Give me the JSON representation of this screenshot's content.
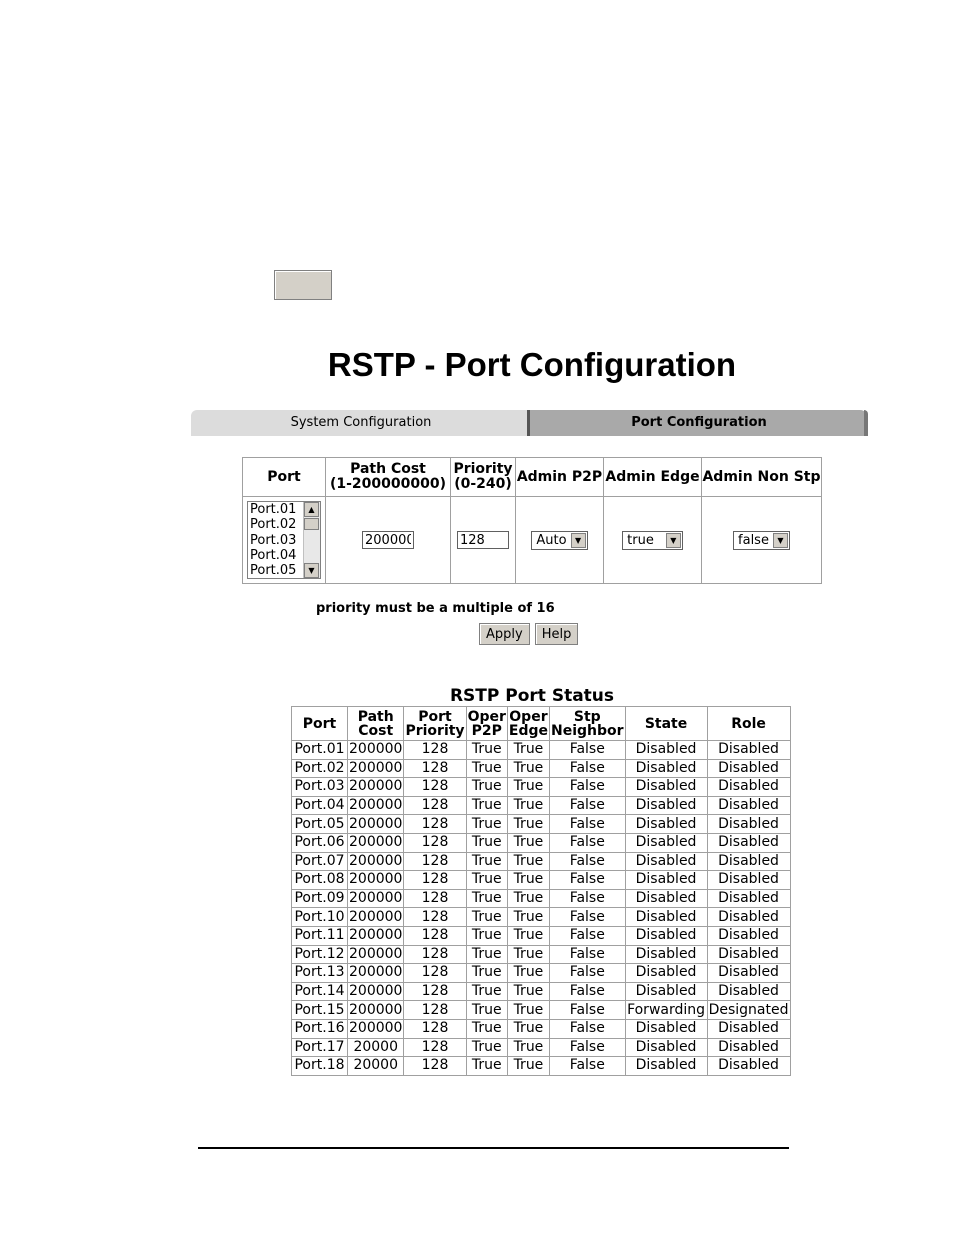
{
  "page_title": "RSTP - Port Configuration",
  "tabs": [
    {
      "label": "System Configuration"
    },
    {
      "label": "Port Configuration"
    }
  ],
  "config_table": {
    "headers": {
      "port": "Port",
      "path_cost": "Path Cost",
      "path_cost_range": "(1-200000000)",
      "priority": "Priority",
      "priority_range": "(0-240)",
      "admin_p2p": "Admin P2P",
      "admin_edge": "Admin Edge",
      "admin_non_stp": "Admin Non Stp"
    },
    "port_options": [
      "Port.01",
      "Port.02",
      "Port.03",
      "Port.04",
      "Port.05"
    ],
    "path_cost_value": "200000",
    "priority_value": "128",
    "admin_p2p_value": "Auto",
    "admin_edge_value": "true",
    "admin_non_stp_value": "false"
  },
  "note": "priority must be a multiple of 16",
  "buttons": {
    "apply": "Apply",
    "help": "Help"
  },
  "status": {
    "title": "RSTP Port Status",
    "headers": {
      "port": "Port",
      "path_cost_1": "Path",
      "path_cost_2": "Cost",
      "port_priority_1": "Port",
      "port_priority_2": "Priority",
      "oper_p2p_1": "Oper",
      "oper_p2p_2": "P2P",
      "oper_edge_1": "Oper",
      "oper_edge_2": "Edge",
      "stp_neighbor_1": "Stp",
      "stp_neighbor_2": "Neighbor",
      "state": "State",
      "role": "Role"
    },
    "rows": [
      [
        "Port.01",
        "200000",
        "128",
        "True",
        "True",
        "False",
        "Disabled",
        "Disabled"
      ],
      [
        "Port.02",
        "200000",
        "128",
        "True",
        "True",
        "False",
        "Disabled",
        "Disabled"
      ],
      [
        "Port.03",
        "200000",
        "128",
        "True",
        "True",
        "False",
        "Disabled",
        "Disabled"
      ],
      [
        "Port.04",
        "200000",
        "128",
        "True",
        "True",
        "False",
        "Disabled",
        "Disabled"
      ],
      [
        "Port.05",
        "200000",
        "128",
        "True",
        "True",
        "False",
        "Disabled",
        "Disabled"
      ],
      [
        "Port.06",
        "200000",
        "128",
        "True",
        "True",
        "False",
        "Disabled",
        "Disabled"
      ],
      [
        "Port.07",
        "200000",
        "128",
        "True",
        "True",
        "False",
        "Disabled",
        "Disabled"
      ],
      [
        "Port.08",
        "200000",
        "128",
        "True",
        "True",
        "False",
        "Disabled",
        "Disabled"
      ],
      [
        "Port.09",
        "200000",
        "128",
        "True",
        "True",
        "False",
        "Disabled",
        "Disabled"
      ],
      [
        "Port.10",
        "200000",
        "128",
        "True",
        "True",
        "False",
        "Disabled",
        "Disabled"
      ],
      [
        "Port.11",
        "200000",
        "128",
        "True",
        "True",
        "False",
        "Disabled",
        "Disabled"
      ],
      [
        "Port.12",
        "200000",
        "128",
        "True",
        "True",
        "False",
        "Disabled",
        "Disabled"
      ],
      [
        "Port.13",
        "200000",
        "128",
        "True",
        "True",
        "False",
        "Disabled",
        "Disabled"
      ],
      [
        "Port.14",
        "200000",
        "128",
        "True",
        "True",
        "False",
        "Disabled",
        "Disabled"
      ],
      [
        "Port.15",
        "200000",
        "128",
        "True",
        "True",
        "False",
        "Forwarding",
        "Designated"
      ],
      [
        "Port.16",
        "200000",
        "128",
        "True",
        "True",
        "False",
        "Disabled",
        "Disabled"
      ],
      [
        "Port.17",
        "20000",
        "128",
        "True",
        "True",
        "False",
        "Disabled",
        "Disabled"
      ],
      [
        "Port.18",
        "20000",
        "128",
        "True",
        "True",
        "False",
        "Disabled",
        "Disabled"
      ]
    ]
  }
}
